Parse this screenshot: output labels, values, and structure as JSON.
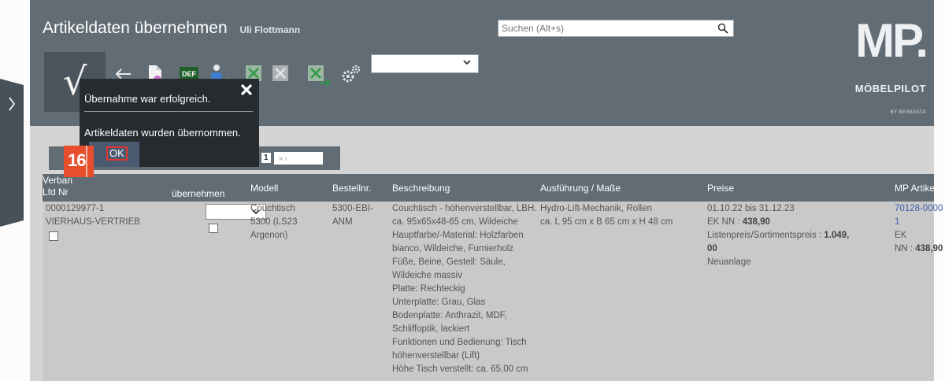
{
  "header": {
    "title": "Artikeldaten übernehmen",
    "user": "Uli Flottmann",
    "search_placeholder": "Suchen (Alt+s)"
  },
  "toolbar": {
    "confirm_label": "√",
    "def_label": "DEF",
    "icons": [
      "back-arrow-icon",
      "document-icon",
      "def-icon",
      "person-edit-icon",
      "excel-green-icon",
      "excel-gray-icon",
      "excel-export-icon",
      "settings-gears-icon"
    ]
  },
  "logo": {
    "mark": "MP.",
    "brand": "MÖBELPILOT",
    "sub": "BY BEWIDATA"
  },
  "popup": {
    "title": "Übernahme war erfolgreich.",
    "message": "Artikeldaten wurden übernommen.",
    "ok_label": "OK"
  },
  "step_badge": "16",
  "pager": {
    "current": "1",
    "next_symbols": "» ›"
  },
  "grid": {
    "columns": {
      "verband": "Verban",
      "lfd_nr": "Lfd Nr",
      "uebernehmen": "übernehmen",
      "modell": "Modell",
      "bestellnr": "Bestellnr.",
      "beschreibung": "Beschreibung",
      "ausfuehrung": "Ausführung / Maße",
      "preise": "Preise",
      "mp_artikel": "MP Artikel"
    },
    "row": {
      "lfd_nr": "0000129977-1",
      "verband": "VIERHAUS-VERTRIEB",
      "modell": [
        "Couchtisch",
        "5300 (LS23",
        "Argenon)"
      ],
      "bestellnr": [
        "5300-EBI-",
        "ANM"
      ],
      "beschreibung": [
        "Couchtisch - höhenverstellbar, LBH.",
        "ca. 95x65x48-65 cm, Wildeiche",
        "Hauptfarbe/-Material: Holzfarben",
        "bianco, Wildeiche, Furnierholz",
        "Füße, Beine, Gestell: Säule,",
        "Wildeiche massiv",
        "Platte: Rechteckig",
        "Unterplatte: Grau, Glas",
        "Bodenplatte: Anthrazit, MDF,",
        "Schliffoptik, lackiert",
        "Funktionen und Bedienung: Tisch",
        "höhenverstellbar (Lift)",
        "Höhe Tisch verstellt: ca. 65,00 cm"
      ],
      "ausfuehrung": [
        "Hydro-Lift-Mechanik, Rollen",
        "ca. L 95 cm x B 65 cm x H 48 cm"
      ],
      "preise": {
        "period": "01.10.22 bis 31.12.23",
        "ek_label": "EK NN : ",
        "ek_value": "438,90",
        "listen_label": "Listenpreis/Sortimentspreis : ",
        "listen_value_a": "1.049,",
        "listen_value_b": "00",
        "status": "Neuanlage"
      },
      "mp_artikel": {
        "link_a": "70128-0000",
        "link_b": "1",
        "ek_label": "EK",
        "nn_label": "NN : ",
        "nn_value": "438,90"
      }
    }
  }
}
